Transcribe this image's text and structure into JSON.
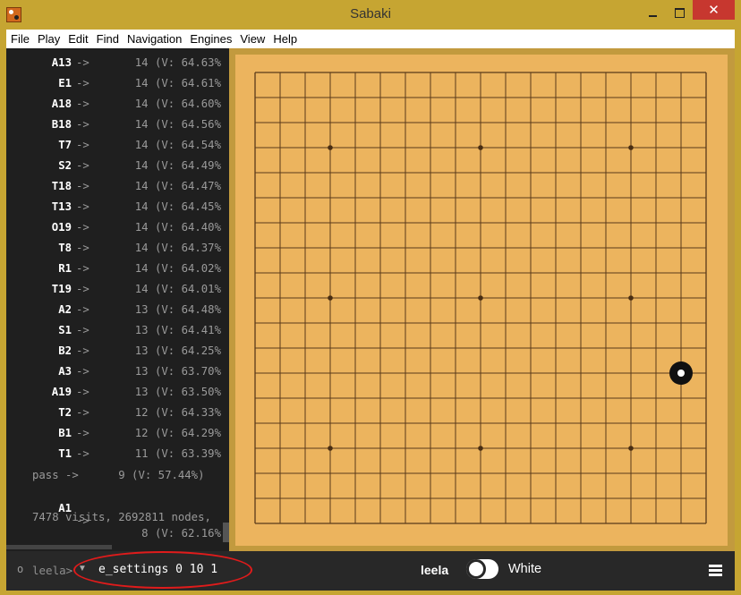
{
  "window": {
    "title": "Sabaki",
    "close_glyph": "✕"
  },
  "menu": [
    "File",
    "Play",
    "Edit",
    "Find",
    "Navigation",
    "Engines",
    "View",
    "Help"
  ],
  "engine_log": {
    "rows": [
      {
        "move": "A13",
        "visits": "14",
        "value": "(V: 64.63%"
      },
      {
        "move": "E1",
        "visits": "14",
        "value": "(V: 64.61%"
      },
      {
        "move": "A18",
        "visits": "14",
        "value": "(V: 64.60%"
      },
      {
        "move": "B18",
        "visits": "14",
        "value": "(V: 64.56%"
      },
      {
        "move": "T7",
        "visits": "14",
        "value": "(V: 64.54%"
      },
      {
        "move": "S2",
        "visits": "14",
        "value": "(V: 64.49%"
      },
      {
        "move": "T18",
        "visits": "14",
        "value": "(V: 64.47%"
      },
      {
        "move": "T13",
        "visits": "14",
        "value": "(V: 64.45%"
      },
      {
        "move": "O19",
        "visits": "14",
        "value": "(V: 64.40%"
      },
      {
        "move": "T8",
        "visits": "14",
        "value": "(V: 64.37%"
      },
      {
        "move": "R1",
        "visits": "14",
        "value": "(V: 64.02%"
      },
      {
        "move": "T19",
        "visits": "14",
        "value": "(V: 64.01%"
      },
      {
        "move": "A2",
        "visits": "13",
        "value": "(V: 64.48%"
      },
      {
        "move": "S1",
        "visits": "13",
        "value": "(V: 64.41%"
      },
      {
        "move": "B2",
        "visits": "13",
        "value": "(V: 64.25%"
      },
      {
        "move": "A3",
        "visits": "13",
        "value": "(V: 63.70%"
      },
      {
        "move": "A19",
        "visits": "13",
        "value": "(V: 63.50%"
      },
      {
        "move": "T2",
        "visits": "12",
        "value": "(V: 64.33%"
      },
      {
        "move": "B1",
        "visits": "12",
        "value": "(V: 64.29%"
      },
      {
        "move": "T1",
        "visits": "11",
        "value": "(V: 63.39%"
      }
    ],
    "arrow": "->",
    "pass_row": "pass ->      9 (V: 57.44%)",
    "a1_row": {
      "move": "A1",
      "visits": "8",
      "value": "(V: 62.16%"
    },
    "summary": "7478 visits, 2692811 nodes,"
  },
  "bottom": {
    "engine_prompt": "leela>",
    "command": "e_settings 0 10 1",
    "black_player": "leela",
    "white_player": "White",
    "active_player": "white"
  },
  "board": {
    "size": 19,
    "stars": [
      [
        3,
        3
      ],
      [
        9,
        3
      ],
      [
        15,
        3
      ],
      [
        3,
        9
      ],
      [
        9,
        9
      ],
      [
        15,
        9
      ],
      [
        3,
        15
      ],
      [
        9,
        15
      ],
      [
        15,
        15
      ]
    ],
    "stones": [
      {
        "color": "black",
        "col": 17,
        "row": 12,
        "marker": "last-move"
      }
    ]
  }
}
